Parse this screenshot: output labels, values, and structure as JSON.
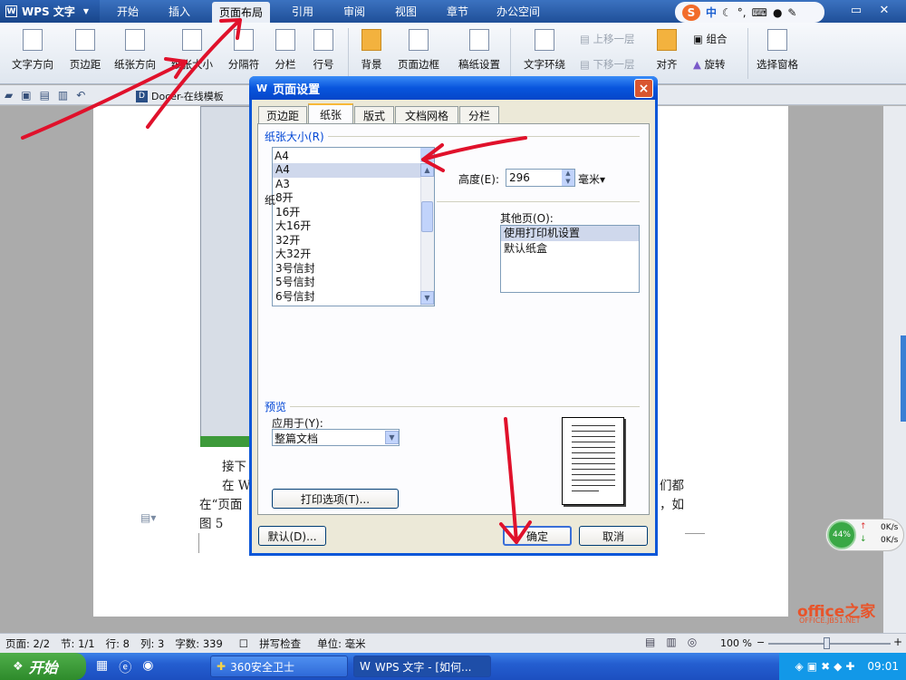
{
  "app": {
    "name": "WPS 文字"
  },
  "menu_tabs": [
    {
      "label": "开始"
    },
    {
      "label": "插入"
    },
    {
      "label": "页面布局"
    },
    {
      "label": "引用"
    },
    {
      "label": "审阅"
    },
    {
      "label": "视图"
    },
    {
      "label": "章节"
    },
    {
      "label": "办公空间"
    }
  ],
  "ime": {
    "logo": "S",
    "lang": "中"
  },
  "ribbon": {
    "text_direction": "文字方向",
    "margins": "页边距",
    "orientation": "纸张方向",
    "paper_size": "纸张大小",
    "breaks": "分隔符",
    "columns": "分栏",
    "line_numbers": "行号",
    "background": "背景",
    "page_border": "页面边框",
    "manuscript": "稿纸设置",
    "wrap_text": "文字环绕",
    "bring_forward": "上移一层",
    "send_backward": "下移一层",
    "align": "对齐",
    "group": "组合",
    "rotate": "旋转",
    "selection_pane": "选择窗格"
  },
  "qat": {
    "docer_label": "Docer-在线模板"
  },
  "document": {
    "line1": "接下",
    "line2_start": "在 W",
    "line2_end": "们都",
    "line3_start": "在“页面",
    "line3_end": "，如",
    "line4": "图 5"
  },
  "dialog": {
    "title": "页面设置",
    "close": "×",
    "tabs": [
      {
        "label": "页边距"
      },
      {
        "label": "纸张"
      },
      {
        "label": "版式"
      },
      {
        "label": "文档网格"
      },
      {
        "label": "分栏"
      }
    ],
    "paper_size_label": "纸张大小(R)",
    "paper_size_value": "A4",
    "paper_options": [
      "A4",
      "A3",
      "8开",
      "16开",
      "大16开",
      "32开",
      "大32开",
      "3号信封",
      "5号信封",
      "6号信封"
    ],
    "paper_source_label_partial": "纸",
    "height_label": "高度(E):",
    "height_value": "296",
    "height_unit": "毫米",
    "other_pages_label": "其他页(O):",
    "other_pages_options": [
      "使用打印机设置",
      "默认纸盒"
    ],
    "preview_label": "预览",
    "apply_to_label": "应用于(Y):",
    "apply_to_value": "整篇文档",
    "print_options_button": "打印选项(T)...",
    "default_button": "默认(D)...",
    "ok_button": "确定",
    "cancel_button": "取消"
  },
  "network_widget": {
    "percent": "44%",
    "up": "0K/s",
    "down": "0K/s"
  },
  "watermark": {
    "text": "office之家",
    "subtext": "OFFICE.JB51.NET"
  },
  "statusbar": {
    "page": "页面: 2/2",
    "section": "节: 1/1",
    "row": "行: 8",
    "col": "列: 3",
    "words": "字数: 339",
    "spell": "拼写检查",
    "unit": "单位: 毫米",
    "zoom": "100 %"
  },
  "taskbar": {
    "start": "开始",
    "items": [
      {
        "label": "360安全卫士"
      },
      {
        "label": "WPS 文字 - [如何..."
      }
    ],
    "clock": "09:01"
  },
  "colors": {
    "title_blue": "#1f4f98",
    "dialog_blue": "#0855dd",
    "annotation_red": "#e0112b"
  }
}
